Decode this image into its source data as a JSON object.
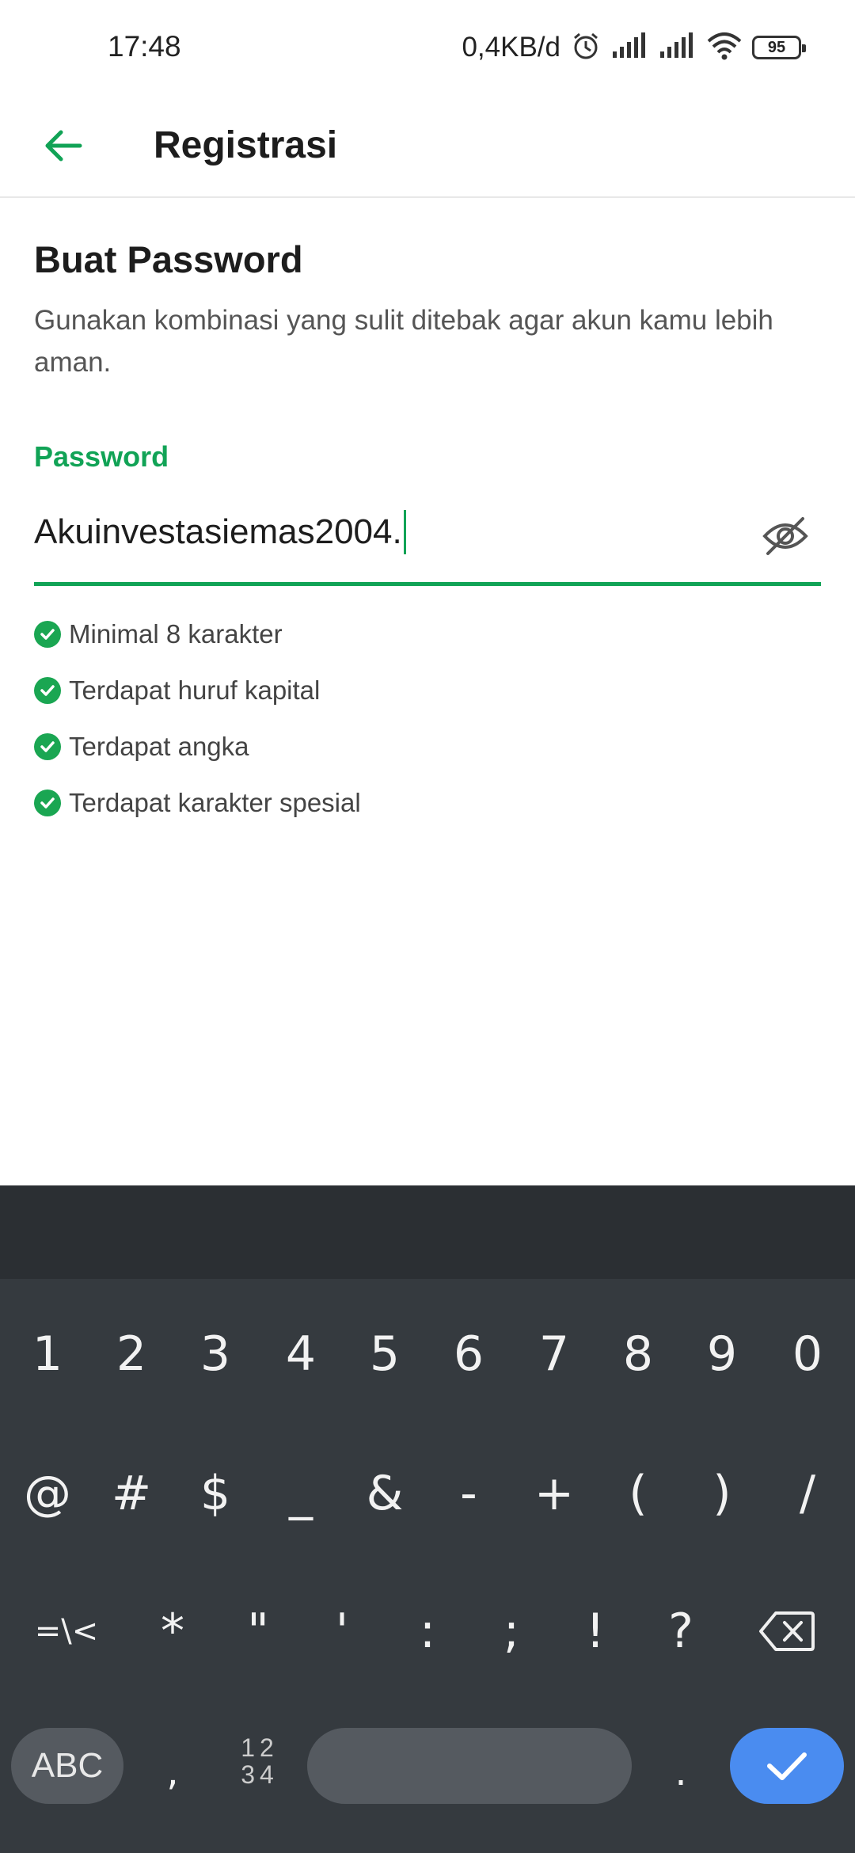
{
  "status_bar": {
    "time": "17:48",
    "net_speed": "0,4KB/d",
    "battery": "95"
  },
  "app_bar": {
    "title": "Registrasi",
    "back_icon": "arrow-left-icon"
  },
  "content": {
    "heading": "Buat Password",
    "subtitle": "Gunakan kombinasi yang sulit ditebak agar akun kamu lebih aman.",
    "password_label": "Password",
    "password_value": "Akuinvestasiemas2004.",
    "visibility_icon": "eye-off-icon",
    "rules": [
      {
        "text": "Minimal 8 karakter"
      },
      {
        "text": "Terdapat huruf kapital"
      },
      {
        "text": "Terdapat angka"
      },
      {
        "text": "Terdapat karakter spesial"
      }
    ]
  },
  "keyboard": {
    "row1": [
      "1",
      "2",
      "3",
      "4",
      "5",
      "6",
      "7",
      "8",
      "9",
      "0"
    ],
    "row2": [
      "@",
      "#",
      "$",
      "_",
      "&",
      "-",
      "+",
      "(",
      ")",
      "/"
    ],
    "row3": [
      "=\\<",
      "*",
      "\"",
      "'",
      ":",
      ";",
      "!",
      "?"
    ],
    "abc_label": "ABC",
    "comma": ",",
    "num_toggle": "12 34",
    "period": ".",
    "backspace_icon": "backspace-icon",
    "done_icon": "check-icon"
  },
  "colors": {
    "accent": "#11a356",
    "keyboard_bg": "#353a3f",
    "done_key": "#4a8cf0"
  }
}
